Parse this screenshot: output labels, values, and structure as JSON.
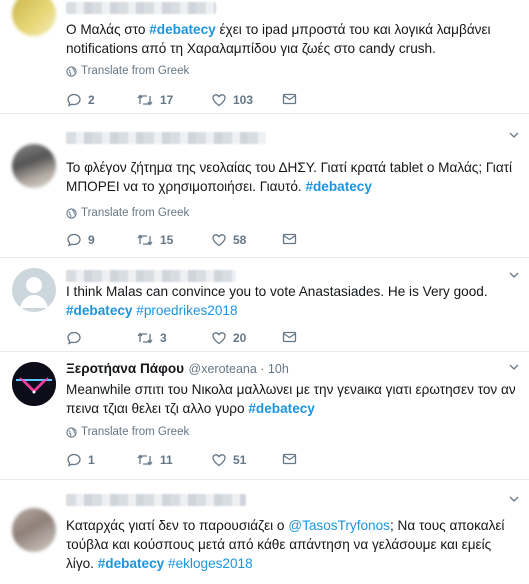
{
  "tweets": [
    {
      "text_parts": [
        "Ο Μαλάς στο ",
        "#debatecy",
        " έχει το ipad μπροστά του και λογικά λαμβάνει notifications από τη Χαραλαμπίδου για ζωές στο candy crush."
      ],
      "translate": "Translate from Greek",
      "replies": "2",
      "retweets": "17",
      "likes": "103"
    },
    {
      "text_parts": [
        "Το φλέγον ζήτημα της νεολαίας του ΔΗΣΥ. Γιατί κρατά tablet ο Μαλάς; Γιατί ΜΠΟΡΕΙ να το χρησιμοποιήσει. Γιαυτό.  ",
        "#debatecy"
      ],
      "translate": "Translate from Greek",
      "replies": "9",
      "retweets": "15",
      "likes": "58"
    },
    {
      "text_parts": [
        "I think Malas can convince you to vote Anastasiades. He is Very good. ",
        "#debatecy",
        " ",
        "#proedrikes2018"
      ],
      "replies": "",
      "retweets": "3",
      "likes": "20"
    },
    {
      "author_name": "Ξεροτήανα Πάφου",
      "author_handle": "@xeroteana · 10h",
      "text_parts": [
        "Meanwhile σπιτι του Νικολα μαλλωνει με την γενaικα γιατι ερωτησεν τον αν πεινα τζιαι θελει τζι αλλο γυρο ",
        "#debatecy"
      ],
      "translate": "Translate from Greek",
      "replies": "1",
      "retweets": "11",
      "likes": "51"
    },
    {
      "text_parts": [
        "Καταρχάς γιατί δεν το παρουσιάζει ο ",
        "@TasosTryfonos",
        "; Να τους αποκαλεί τούβλα και κούσπους μετά από κάθε απάντηση να γελάσουμε και εμείς λίγο. ",
        "#debatecy",
        " ",
        "#ekloges2018"
      ]
    }
  ],
  "colors": {
    "link": "#1b95e0",
    "muted": "#657786",
    "border": "#e6ecf0"
  },
  "icons": [
    "reply-icon",
    "retweet-icon",
    "like-icon",
    "message-icon",
    "globe-icon",
    "chevron-down-icon"
  ]
}
